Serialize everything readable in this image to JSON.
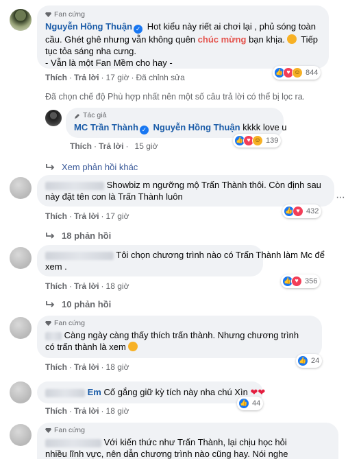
{
  "fan_badge": "Fan cứng",
  "author_badge": "Tác giả",
  "c1": {
    "author": "Nguyễn Hồng Thuận",
    "line1": "Hot kiểu này riết ai chơi lại , phủ sóng toàn",
    "line2a": "cầu. Ghét ghê nhưng vẫn không quên ",
    "line2b": "chúc mừng",
    "line2c": " bạn khịa.",
    "line3": "tục tỏa sáng nha cưng.",
    "line4": "- Vẫn là một Fan Mềm cho hay -",
    "like": "Thích",
    "reply": "Trả lời",
    "time": "17 giờ",
    "edited": "Đã chỉnh sửa",
    "react_count": "844"
  },
  "filter_note": "Đã chọn chế độ Phù hợp nhất nên một số câu trả lời có thể bị lọc ra.",
  "r1": {
    "author": "MC Trần Thành",
    "mention": "Nguyễn Hồng Thuận",
    "text": " kkkk love u",
    "like": "Thích",
    "reply": "Trả lời",
    "time": "15 giờ",
    "react_count": "139"
  },
  "more_replies": "Xem phản hồi khác",
  "c2": {
    "line1": "Showbiz m ngưỡng mộ Trấn Thành thôi. Còn định sau",
    "line2": "này đặt tên con là Trấn Thành luôn",
    "like": "Thích",
    "reply": "Trả lời",
    "time": "17 giờ",
    "react_count": "432",
    "replies": "18 phản hồi"
  },
  "c3": {
    "line1": "Tôi chọn chương trình nào có Trấn Thành làm Mc để",
    "line2": "xem .",
    "like": "Thích",
    "reply": "Trả lời",
    "time": "18 giờ",
    "react_count": "356",
    "replies": "10 phản hồi"
  },
  "c4": {
    "line1": "Càng ngày càng thấy thích trấn thành. Nhưng chương trình",
    "line2": "có trấn thành là xem",
    "like": "Thích",
    "reply": "Trả lời",
    "time": "18 giờ",
    "react_count": "24"
  },
  "c5": {
    "author_visible": "Em",
    "text": "Cố gắng giữ kỳ tích này nha chú Xìn",
    "like": "Thích",
    "reply": "Trả lời",
    "time": "18 giờ",
    "react_count": "44"
  },
  "c6": {
    "line1": "Với kiến thức như Trấn Thành, lại chịu học hỏi",
    "line2": "nhiều lĩnh vực, nên dẫn chương trình nào cũng hay. Nói nghe"
  }
}
